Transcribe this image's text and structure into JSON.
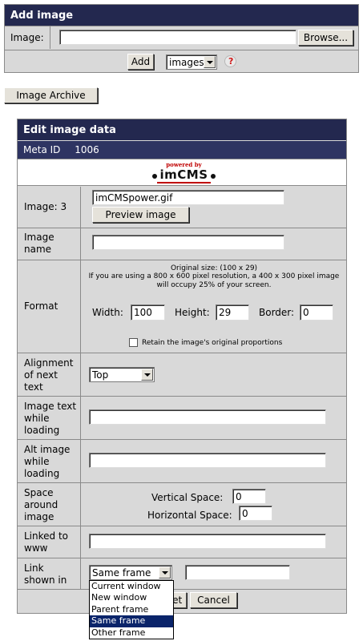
{
  "add_image": {
    "title": "Add image",
    "image_label": "Image:",
    "image_value": "",
    "browse_label": "Browse...",
    "add_label": "Add",
    "folder_selected": "images",
    "help_icon": "question-mark-icon"
  },
  "archive_button": "Image Archive",
  "edit": {
    "title": "Edit image data",
    "meta_label": "Meta ID",
    "meta_value": "1006",
    "logo_powered": "powered by",
    "logo_text": "imCMS",
    "image_label": "Image: 3",
    "image_file": "imCMSpower.gif",
    "preview_label": "Preview image",
    "name_label": "Image name",
    "name_value": "",
    "format_label": "Format",
    "orig_size": "Original size: (100 x 29)",
    "resolution_note": "If you are using a 800 x 600 pixel resolution, a 400 x 300 pixel image will occupy 25% of your screen.",
    "width_label": "Width:",
    "width_value": "100",
    "height_label": "Height:",
    "height_value": "29",
    "border_label": "Border:",
    "border_value": "0",
    "retain_label": "Retain the image's original proportions",
    "retain_checked": false,
    "align_label": "Alignment of next text",
    "align_value": "Top",
    "loading_text_label": "Image text while loading",
    "loading_text_value": "",
    "alt_label": "Alt image while loading",
    "alt_value": "",
    "space_label": "Space around image",
    "vspace_label": "Vertical Space:",
    "vspace_value": "0",
    "hspace_label": "Horizontal Space:",
    "hspace_value": "0",
    "linked_label": "Linked to www",
    "linked_value": "",
    "link_shown_label": "Link shown in",
    "link_target_selected": "Same frame",
    "link_target_other": "",
    "link_target_options": [
      "Current window",
      "New window",
      "Parent frame",
      "Same frame",
      "Other frame"
    ],
    "reset_label": "Reset",
    "cancel_label": "Cancel"
  }
}
